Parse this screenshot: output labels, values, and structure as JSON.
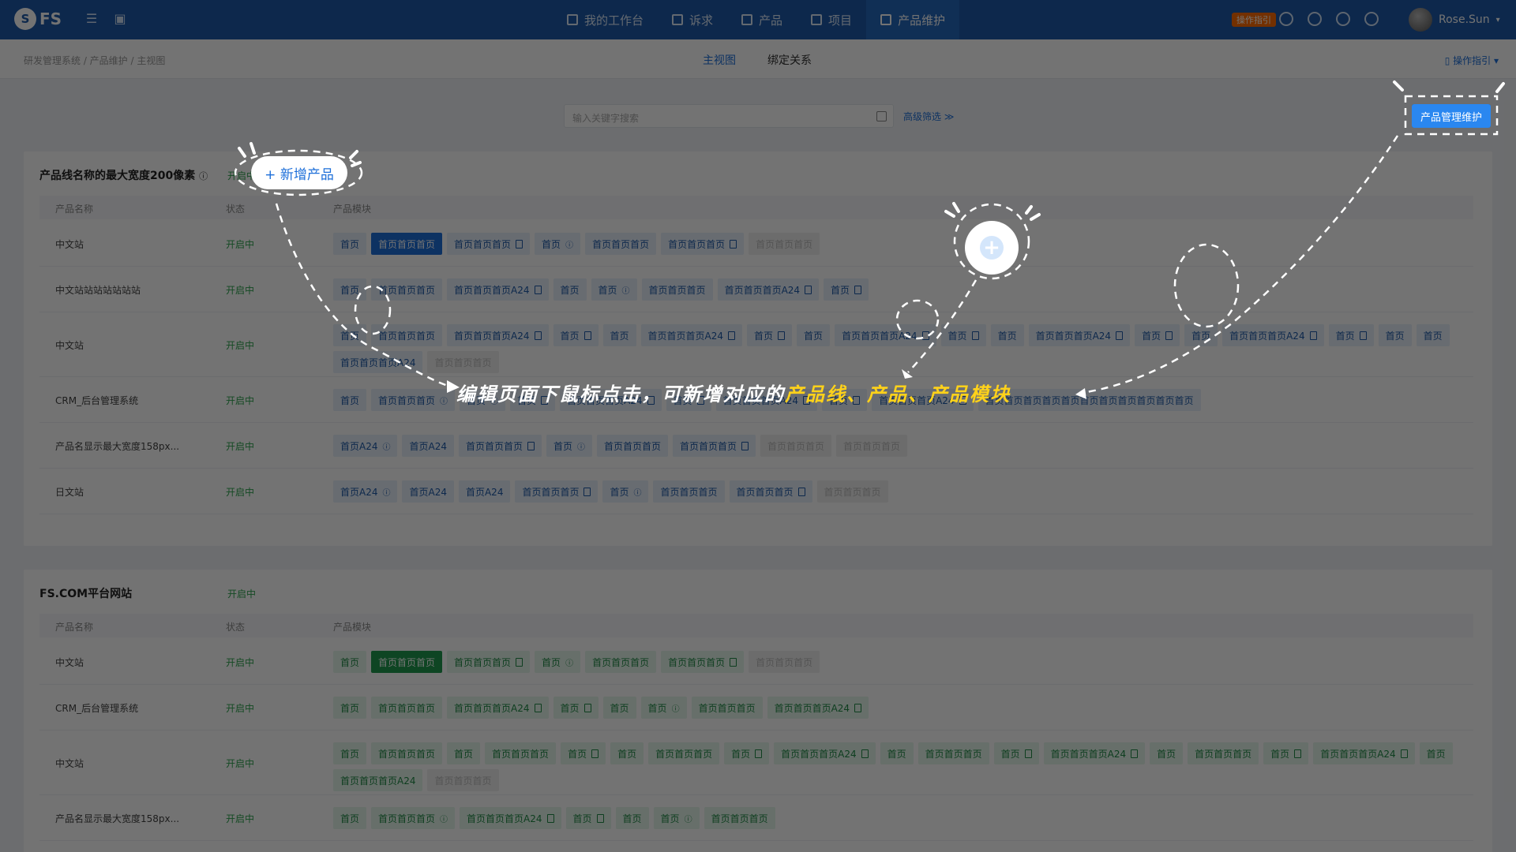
{
  "app": {
    "logo": "FS"
  },
  "nav": [
    {
      "label": "我的工作台",
      "active": false
    },
    {
      "label": "诉求",
      "active": false
    },
    {
      "label": "产品",
      "active": false
    },
    {
      "label": "项目",
      "active": false
    },
    {
      "label": "产品维护",
      "active": true
    }
  ],
  "top_right": {
    "help_badge": "操作指引",
    "user_name": "Rose.Sun"
  },
  "breadcrumb": "研发管理系统  /  产品维护  /  主视图",
  "tabs": [
    {
      "label": "主视图",
      "active": true
    },
    {
      "label": "绑定关系",
      "active": false
    }
  ],
  "op_guide": "操作指引",
  "search": {
    "placeholder": "输入关键字搜索",
    "advanced": "高级筛选"
  },
  "pm_button": "产品管理维护",
  "panel1": {
    "title": "产品线名称的最大宽度200像素",
    "status": "开启中",
    "headers": [
      "产品名称",
      "状态",
      "产品模块"
    ],
    "rows": [
      {
        "name": "中文站",
        "status": "开启中",
        "chips": [
          [
            "首页",
            ""
          ],
          [
            "首页首页首页",
            "dark"
          ],
          [
            "首页首页首页",
            "bm"
          ],
          [
            "首页",
            "q"
          ],
          [
            "首页首页首页",
            ""
          ],
          [
            "首页首页首页",
            "bm"
          ],
          [
            "首页首页首页",
            "dis"
          ]
        ]
      },
      {
        "name": "中文站站站站站站站",
        "status": "开启中",
        "chips": [
          [
            "首页",
            ""
          ],
          [
            "首页首页首页",
            ""
          ],
          [
            "首页首页首页A24",
            "bm"
          ],
          [
            "首页",
            ""
          ],
          [
            "首页",
            "q"
          ],
          [
            "首页首页首页",
            ""
          ],
          [
            "首页首页首页A24",
            "bm"
          ],
          [
            "首页",
            "bm"
          ]
        ]
      },
      {
        "name": "中文站",
        "status": "开启中",
        "chips": [
          [
            "首页",
            ""
          ],
          [
            "首页首页首页",
            ""
          ],
          [
            "首页首页首页A24",
            "bm"
          ],
          [
            "首页",
            "bm"
          ],
          [
            "首页",
            ""
          ],
          [
            "首页首页首页A24",
            "bm"
          ],
          [
            "首页",
            "bm"
          ],
          [
            "首页",
            ""
          ],
          [
            "首页首页首页A24",
            "bm"
          ],
          [
            "首页",
            "bm"
          ],
          [
            "首页",
            ""
          ],
          [
            "首页首页首页A24",
            "bm"
          ],
          [
            "首页",
            "bm"
          ],
          [
            "首页",
            ""
          ],
          [
            "首页首页首页A24",
            "bm"
          ],
          [
            "首页",
            "bm"
          ],
          [
            "首页",
            ""
          ],
          [
            "首页",
            ""
          ],
          [
            "首页首页首页A24",
            ""
          ],
          [
            "首页首页首页",
            "dis"
          ]
        ]
      },
      {
        "name": "CRM_后台管理系统",
        "status": "开启中",
        "chips": [
          [
            "首页",
            ""
          ],
          [
            "首页首页首页",
            "q"
          ],
          [
            "首页",
            "q"
          ],
          [
            "首页",
            "bm"
          ],
          [
            "首页首页首页A24",
            "bm"
          ],
          [
            "首页",
            "bm"
          ],
          [
            "首页首页首页A24",
            "bm"
          ],
          [
            "首页",
            "bm"
          ],
          [
            "首页首页首页A24",
            "bm"
          ],
          [
            "首页首页首页首页首页首页首页首页首页首页首页",
            ""
          ]
        ]
      },
      {
        "name": "产品名显示最大宽度158px...",
        "status": "开启中",
        "chips": [
          [
            "首页A24",
            "q"
          ],
          [
            "首页A24",
            ""
          ],
          [
            "首页首页首页",
            "bm"
          ],
          [
            "首页",
            "q"
          ],
          [
            "首页首页首页",
            ""
          ],
          [
            "首页首页首页",
            "bm"
          ],
          [
            "首页首页首页",
            "dis"
          ],
          [
            "首页首页首页",
            "dis"
          ]
        ]
      },
      {
        "name": "日文站",
        "status": "开启中",
        "chips": [
          [
            "首页A24",
            "q"
          ],
          [
            "首页A24",
            ""
          ],
          [
            "首页A24",
            ""
          ],
          [
            "首页首页首页",
            "bm"
          ],
          [
            "首页",
            "q"
          ],
          [
            "首页首页首页",
            ""
          ],
          [
            "首页首页首页",
            "bm"
          ],
          [
            "首页首页首页",
            "dis"
          ]
        ]
      }
    ]
  },
  "panel2": {
    "title": "FS.COM平台网站",
    "status": "开启中",
    "headers": [
      "产品名称",
      "状态",
      "产品模块"
    ],
    "rows": [
      {
        "name": "中文站",
        "status": "开启中",
        "chips": [
          [
            "首页",
            ""
          ],
          [
            "首页首页首页",
            "dark"
          ],
          [
            "首页首页首页",
            "bm"
          ],
          [
            "首页",
            "q"
          ],
          [
            "首页首页首页",
            ""
          ],
          [
            "首页首页首页",
            "bm"
          ],
          [
            "首页首页首页",
            "dis"
          ]
        ]
      },
      {
        "name": "CRM_后台管理系统",
        "status": "开启中",
        "chips": [
          [
            "首页",
            ""
          ],
          [
            "首页首页首页",
            ""
          ],
          [
            "首页首页首页A24",
            "bm"
          ],
          [
            "首页",
            "bm"
          ],
          [
            "首页",
            ""
          ],
          [
            "首页",
            "q"
          ],
          [
            "首页首页首页",
            ""
          ],
          [
            "首页首页首页A24",
            "bm"
          ]
        ]
      },
      {
        "name": "中文站",
        "status": "开启中",
        "chips": [
          [
            "首页",
            ""
          ],
          [
            "首页首页首页",
            ""
          ],
          [
            "首页",
            ""
          ],
          [
            "首页首页首页",
            ""
          ],
          [
            "首页",
            "bm"
          ],
          [
            "首页",
            ""
          ],
          [
            "首页首页首页",
            ""
          ],
          [
            "首页",
            "bm"
          ],
          [
            "首页首页首页A24",
            "bm"
          ],
          [
            "首页",
            ""
          ],
          [
            "首页首页首页",
            ""
          ],
          [
            "首页",
            "bm"
          ],
          [
            "首页首页首页A24",
            "bm"
          ],
          [
            "首页",
            ""
          ],
          [
            "首页首页首页",
            ""
          ],
          [
            "首页",
            "bm"
          ],
          [
            "首页首页首页A24",
            "bm"
          ],
          [
            "首页",
            ""
          ],
          [
            "首页首页首页A24",
            ""
          ],
          [
            "首页首页首页",
            "dis"
          ]
        ]
      },
      {
        "name": "产品名显示最大宽度158px...",
        "status": "开启中",
        "chips": [
          [
            "首页",
            ""
          ],
          [
            "首页首页首页",
            "q"
          ],
          [
            "首页首页首页A24",
            "bm"
          ],
          [
            "首页",
            "bm"
          ],
          [
            "首页",
            ""
          ],
          [
            "首页",
            "q"
          ],
          [
            "首页首页首页",
            ""
          ]
        ]
      }
    ]
  },
  "annotation": {
    "add_product": "+ 新增产品",
    "hint_prefix": "编辑页面下鼠标点击，可新增对应的",
    "hint_highlight": "产品线、产品、产品模块"
  },
  "colors": {
    "topbar": "#1e5aa8",
    "accent": "#1e6fd9",
    "status_green": "#2ea44f",
    "highlight": "#ffd21a"
  }
}
